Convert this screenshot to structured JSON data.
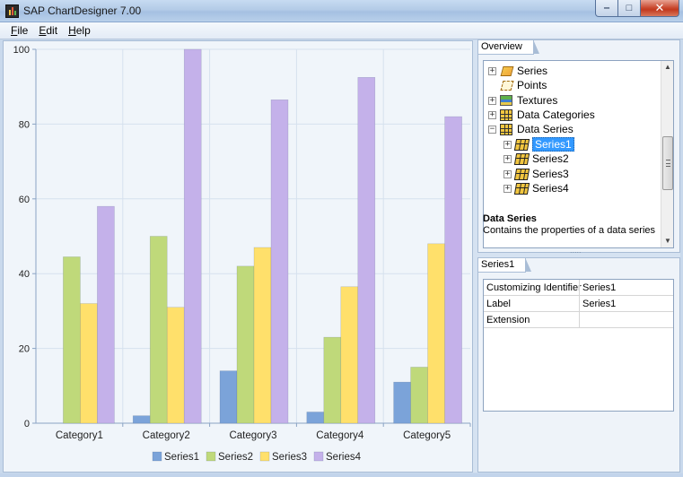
{
  "window": {
    "title": "SAP ChartDesigner 7.00",
    "controls": {
      "minimize": "‒",
      "maximize": "□",
      "close": "✕"
    }
  },
  "menu": [
    {
      "label": "File",
      "accel": "F",
      "rest": "ile"
    },
    {
      "label": "Edit",
      "accel": "E",
      "rest": "dit"
    },
    {
      "label": "Help",
      "accel": "H",
      "rest": "elp"
    }
  ],
  "chart_data": {
    "type": "bar",
    "categories": [
      "Category1",
      "Category2",
      "Category3",
      "Category4",
      "Category5"
    ],
    "series": [
      {
        "name": "Series1",
        "color": "#7ba3d9",
        "values": [
          0,
          2,
          14,
          3,
          11
        ]
      },
      {
        "name": "Series2",
        "color": "#bfd97a",
        "values": [
          44.5,
          50,
          42,
          23,
          15
        ]
      },
      {
        "name": "Series3",
        "color": "#ffe06b",
        "values": [
          32,
          31,
          47,
          36.5,
          48
        ]
      },
      {
        "name": "Series4",
        "color": "#c4b1ea",
        "values": [
          58,
          100,
          86.5,
          92.5,
          82
        ]
      }
    ],
    "ylim": [
      0,
      100
    ],
    "yticks": [
      0,
      20,
      40,
      60,
      80,
      100
    ],
    "grid": true,
    "legend": "bottom",
    "title": "",
    "xlabel": "",
    "ylabel": ""
  },
  "overview": {
    "tab": "Overview",
    "tree": [
      {
        "label": "Series",
        "icon": "series-icon",
        "expander": "+"
      },
      {
        "label": "Points",
        "icon": "points-icon",
        "expander": ""
      },
      {
        "label": "Textures",
        "icon": "textures-icon",
        "expander": "+"
      },
      {
        "label": "Data Categories",
        "icon": "grid-icon",
        "expander": "+"
      },
      {
        "label": "Data Series",
        "icon": "grid-icon",
        "expander": "−"
      },
      {
        "label": "Series1",
        "icon": "data-series-icon",
        "expander": "+",
        "selected": true
      },
      {
        "label": "Series2",
        "icon": "data-series-icon",
        "expander": "+"
      },
      {
        "label": "Series3",
        "icon": "data-series-icon",
        "expander": "+"
      },
      {
        "label": "Series4",
        "icon": "data-series-icon",
        "expander": "+"
      }
    ],
    "description_title": "Data Series",
    "description_text": "Contains the properties of a data series"
  },
  "properties": {
    "tab": "Series1",
    "rows": [
      {
        "key": "Customizing Identifier",
        "value": "Series1"
      },
      {
        "key": "Label",
        "value": "Series1"
      },
      {
        "key": "Extension",
        "value": ""
      }
    ]
  }
}
